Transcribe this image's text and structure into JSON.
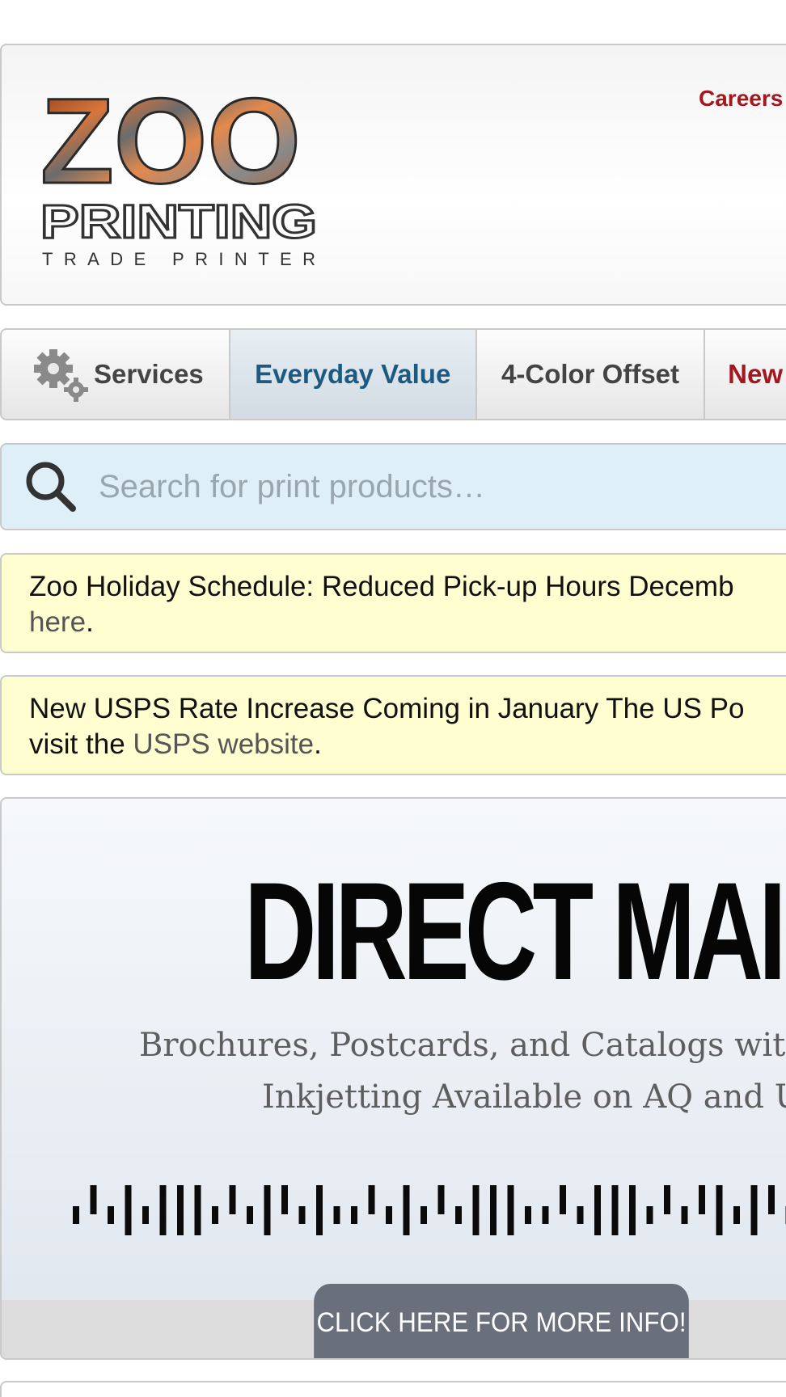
{
  "header": {
    "logo": {
      "word": "ZOO",
      "line2": "PRINTING",
      "line3": "TRADE PRINTER"
    },
    "careers_label": "Careers"
  },
  "nav": {
    "items": [
      {
        "label": "Services",
        "icon": "gears-icon"
      },
      {
        "label": "Everyday Value",
        "active": true
      },
      {
        "label": "4-Color Offset"
      },
      {
        "label": "New"
      }
    ]
  },
  "search": {
    "placeholder": "Search for print products…",
    "value": ""
  },
  "notices": [
    {
      "text": "Zoo Holiday Schedule: Reduced Pick-up Hours Decemb",
      "link_text": "here",
      "suffix": "."
    },
    {
      "text": "New USPS Rate Increase Coming in January The US Po",
      "line2_prefix": "visit the ",
      "link_text": "USPS website",
      "suffix": "."
    }
  ],
  "banner": {
    "title": "DIRECT MAIL",
    "subtitle_line1": "Brochures, Postcards, and Catalogs with",
    "subtitle_line2": "Inkjetting Available on AQ and U",
    "cta_label": "CLICK HERE FOR MORE INFO!"
  },
  "colors": {
    "brand_red": "#a3171f",
    "active_blue": "#1c5a80",
    "notice_bg": "#fffed0",
    "search_bg": "#dfeff8",
    "cta_bg": "#6a6f7c"
  }
}
